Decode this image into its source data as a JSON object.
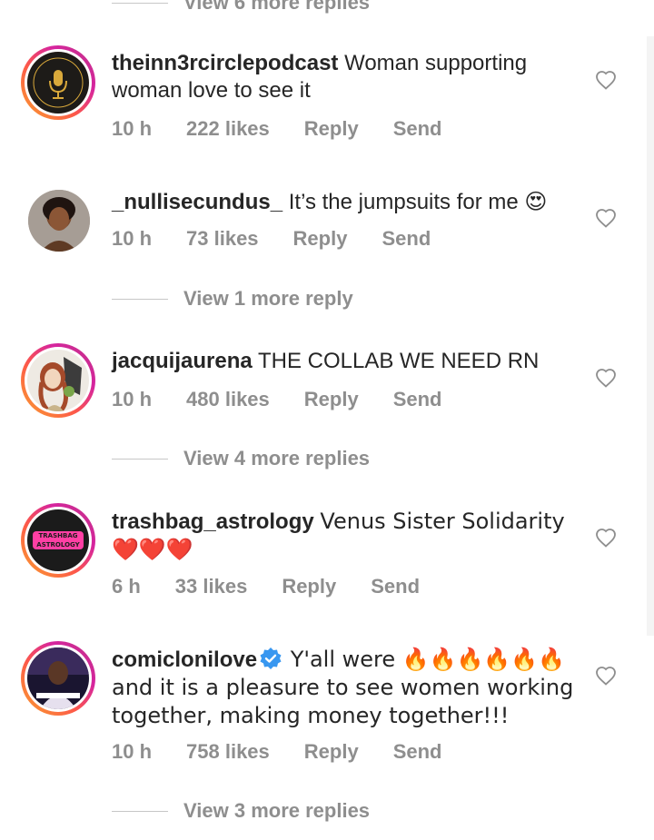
{
  "view_more_top": "View 6 more replies",
  "comments": [
    {
      "username": "theinn3rcirclepodcast",
      "text": "Woman supporting woman love to see it",
      "time": "10 h",
      "likes": "222 likes",
      "reply": "Reply",
      "send": "Send"
    },
    {
      "username": "_nullisecundus_",
      "text": "It’s the jumpsuits for me 😍",
      "time": "10 h",
      "likes": "73 likes",
      "reply": "Reply",
      "send": "Send",
      "view_more": "View 1 more reply"
    },
    {
      "username": "jacquijaurena",
      "text": "THE COLLAB WE NEED RN",
      "time": "10 h",
      "likes": "480 likes",
      "reply": "Reply",
      "send": "Send",
      "view_more": "View 4 more replies"
    },
    {
      "username": "trashbag_astrology",
      "text": "Venus Sister Solidarity ❤️❤️❤️",
      "time": "6 h",
      "likes": "33 likes",
      "reply": "Reply",
      "send": "Send"
    },
    {
      "username": "comicloniloveY",
      "username_display": "comicloniloveY",
      "text": "Y'all were 🔥🔥🔥🔥🔥🔥 and it is a pleasure to see women working together, making money together!!!",
      "time": "10 h",
      "likes": "758 likes",
      "reply": "Reply",
      "send": "Send",
      "view_more": "View 3 more replies"
    }
  ],
  "avatar_texts": {
    "inner_circle": "THE INN3R CIRCLE",
    "trashbag": "TRASHBAG ASTROLOGY"
  },
  "icons": [
    "heart-outline-icon",
    "verified-badge-icon"
  ],
  "colors": {
    "verified": "#3897f0",
    "muted": "#8e8e8e",
    "text": "#262626"
  }
}
